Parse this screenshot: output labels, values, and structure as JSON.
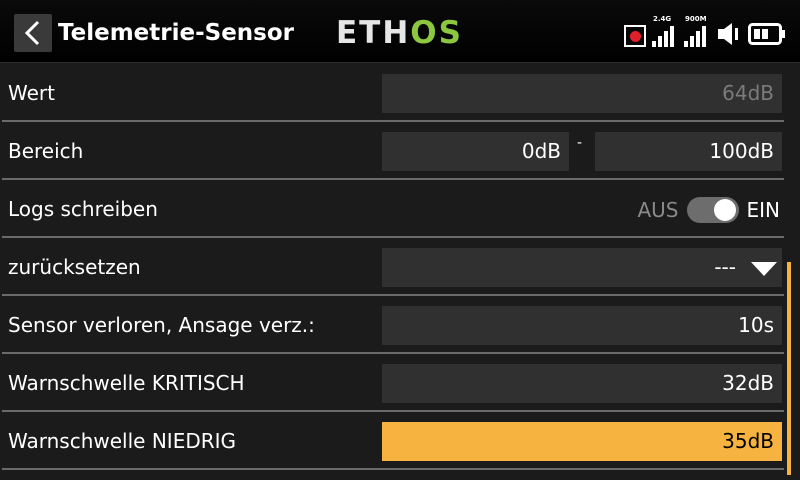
{
  "header": {
    "title": "Telemetrie-Sensor",
    "logo": {
      "left": "ETH",
      "right": "OS"
    },
    "status": {
      "rssi_24_label": "2.4G",
      "rssi_900_label": "900M",
      "battery_level_fraction": 0.25
    }
  },
  "rows": [
    {
      "label": "Wert",
      "value": "64dB"
    },
    {
      "label": "Bereich",
      "min": "0dB",
      "separator": "-",
      "max": "100dB"
    },
    {
      "label": "Logs schreiben",
      "off_label": "AUS",
      "on_label": "EIN",
      "state": "on"
    },
    {
      "label": "zurücksetzen",
      "value": "---"
    },
    {
      "label": "Sensor verloren, Ansage verz.:",
      "value": "10s"
    },
    {
      "label": "Warnschwelle KRITISCH",
      "value": "32dB"
    },
    {
      "label": "Warnschwelle NIEDRIG",
      "value": "35dB"
    }
  ],
  "colors": {
    "accent": "#f7b33f",
    "logo_green": "#8dc63f",
    "record": "#e0202a"
  }
}
